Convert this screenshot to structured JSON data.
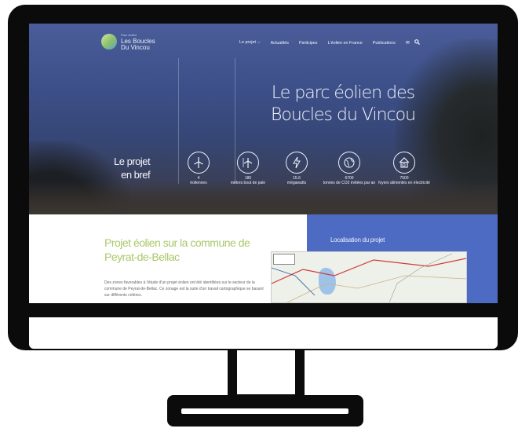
{
  "site": {
    "logo_small": "Parc éolien",
    "logo_line1": "Les Boucles",
    "logo_line2": "Du Vincou"
  },
  "nav": {
    "items": [
      "Le projet ⌵",
      "Actualités",
      "Participez",
      "L'éolien en France",
      "Publications"
    ],
    "icons": [
      "envelope-icon",
      "search-icon"
    ]
  },
  "hero": {
    "title_line1": "Le parc éolien des",
    "title_line2": "Boucles du Vincou",
    "bref_line1": "Le projet",
    "bref_line2": "en bref"
  },
  "stats": [
    {
      "icon": "wind-turbine-icon",
      "num": "4",
      "label": "éoliennes"
    },
    {
      "icon": "turbine-height-icon",
      "num": "180",
      "label": "mètres bout de pale"
    },
    {
      "icon": "lightning-icon",
      "num": "15.6",
      "label": "mégawatts"
    },
    {
      "icon": "globe-icon",
      "num": "6700",
      "label": "tonnes de CO2 évitées par an"
    },
    {
      "icon": "house-icon",
      "num": "7500",
      "label": "foyers alimentés en électricité"
    }
  ],
  "project": {
    "heading": "Projet éolien sur la commune de Peyrat-de-Bellac",
    "text": "Des zones favorables à l'étude d'un projet éolien ont été identifiées sur le secteur de la commune de Peyrat-de-Bellac. Ce zonage est la suite d'un travail cartographique se basant sur différents critères."
  },
  "location": {
    "title": "Localisation du projet"
  },
  "colors": {
    "accent_green": "#a9c86a",
    "panel_blue": "#4e6bc4",
    "bezel": "#0b0b0b"
  }
}
